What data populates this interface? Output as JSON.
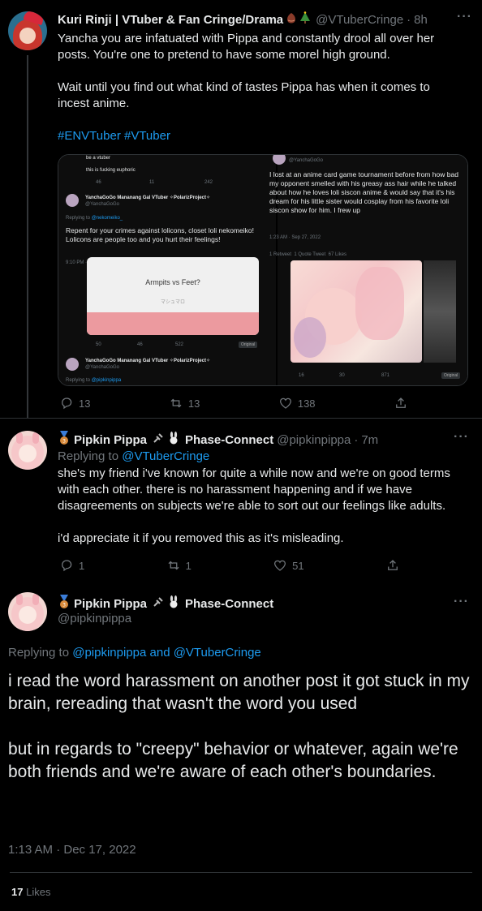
{
  "tweet1": {
    "name": "Kuri Rinji | VTuber & Fan Cringe/Drama",
    "handle": "@VTuberCringe",
    "dot": "·",
    "time": "8h",
    "more": "···",
    "paragraph1": "Yancha you are infatuated with Pippa and constantly drool all over her posts. You're one to pretend to have some morel high ground.",
    "paragraph2": "Wait until you find out what kind of tastes Pippa has when it comes to incest anime.",
    "hashtags": "#ENVTuber #VTuber",
    "media_left": {
      "line_a": "be a vtuber",
      "line_b": "this is fucking euphoric",
      "stats_top": [
        "46",
        "11",
        "242"
      ],
      "author": "YanchaGoGo",
      "author_suffix": "Mananang Gal VTuber ✧PolarizProject✧",
      "author_handle": "@YanchaGoGo",
      "replying": "Replying to",
      "replying_to": "@nekomeiko_",
      "text": "Repent for your crimes against lolicons, closet loli nekomeiko! Lolicons are people too and you hurt their feelings!",
      "time": "9:10 PM · Dec 16, 2022",
      "poll_title": "Armpits vs Feet?",
      "poll_sub": "マシュマロ",
      "stats_bottom": [
        "50",
        "46",
        "522"
      ],
      "badge": "Original",
      "author2": "YanchaGoGo",
      "author2_suffix": "Mananang Gal VTuber ✧PolarizProject✧",
      "author2_handle": "@YanchaGoGo",
      "replying2": "Replying to",
      "replying2_to": "@pipkinpippa"
    },
    "media_right": {
      "handle": "@YanchaGoGo",
      "text": "I lost at an anime card game tournament before from how bad my opponent smelled with his greasy ass hair while he talked about how he loves loli siscon anime & would say that it's his dream for his little sister would cosplay from his favorite loli siscon show for him. I frew up",
      "time": "1:23 AM · Sep 27, 2022",
      "retweet": "1 Retweet",
      "quote": "1 Quote Tweet",
      "likes": "67 Likes",
      "stats": [
        "16",
        "30",
        "871"
      ],
      "badge": "Original"
    },
    "replies": "13",
    "retweets": "13",
    "likes": "138"
  },
  "tweet2": {
    "name": "Pipkin Pippa",
    "name_suffix": "Phase-Connect",
    "handle": "@pipkinpippa",
    "dot": "·",
    "time": "7m",
    "more": "···",
    "replying": "Replying to",
    "replying_to": "@VTuberCringe",
    "paragraph1": "she's my friend i've known for quite a while now and we're on good terms with each other. there is no harassment happening and if we have disagreements on subjects we're able to sort out our feelings like adults.",
    "paragraph2": "i'd appreciate it if you removed this as it's misleading.",
    "replies": "1",
    "retweets": "1",
    "likes": "51"
  },
  "tweet3": {
    "name": "Pipkin Pippa",
    "name_suffix": "Phase-Connect",
    "handle": "@pipkinpippa",
    "more": "···",
    "replying": "Replying to",
    "replying_to": "@pipkinpippa and @VTuberCringe",
    "paragraph1": "i read the word harassment on another post it got stuck in my brain, rereading that wasn't the word you used",
    "paragraph2": "but in regards to \"creepy\" behavior or whatever, again we're both friends and we're aware of each other's boundaries.",
    "timestamp": "1:13 AM · Dec 17, 2022",
    "likes_count": "17",
    "likes_label": "Likes"
  },
  "colors": {
    "background": "#000000",
    "text": "#e7e9ea",
    "secondary": "#71767b",
    "link": "#1d9bf0",
    "divider": "#2f3336"
  }
}
